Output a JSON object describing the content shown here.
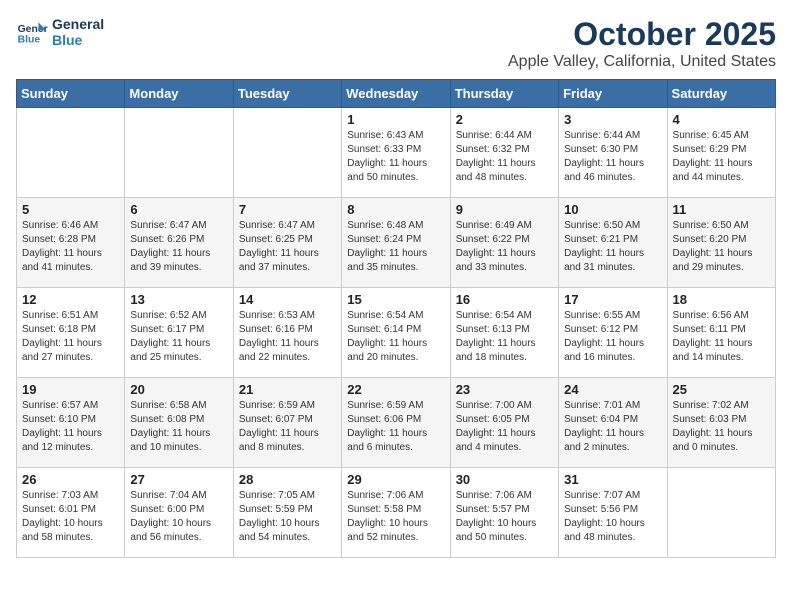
{
  "header": {
    "logo_line1": "General",
    "logo_line2": "Blue",
    "month": "October 2025",
    "location": "Apple Valley, California, United States"
  },
  "days_of_week": [
    "Sunday",
    "Monday",
    "Tuesday",
    "Wednesday",
    "Thursday",
    "Friday",
    "Saturday"
  ],
  "weeks": [
    [
      {
        "day": "",
        "content": ""
      },
      {
        "day": "",
        "content": ""
      },
      {
        "day": "",
        "content": ""
      },
      {
        "day": "1",
        "content": "Sunrise: 6:43 AM\nSunset: 6:33 PM\nDaylight: 11 hours\nand 50 minutes."
      },
      {
        "day": "2",
        "content": "Sunrise: 6:44 AM\nSunset: 6:32 PM\nDaylight: 11 hours\nand 48 minutes."
      },
      {
        "day": "3",
        "content": "Sunrise: 6:44 AM\nSunset: 6:30 PM\nDaylight: 11 hours\nand 46 minutes."
      },
      {
        "day": "4",
        "content": "Sunrise: 6:45 AM\nSunset: 6:29 PM\nDaylight: 11 hours\nand 44 minutes."
      }
    ],
    [
      {
        "day": "5",
        "content": "Sunrise: 6:46 AM\nSunset: 6:28 PM\nDaylight: 11 hours\nand 41 minutes."
      },
      {
        "day": "6",
        "content": "Sunrise: 6:47 AM\nSunset: 6:26 PM\nDaylight: 11 hours\nand 39 minutes."
      },
      {
        "day": "7",
        "content": "Sunrise: 6:47 AM\nSunset: 6:25 PM\nDaylight: 11 hours\nand 37 minutes."
      },
      {
        "day": "8",
        "content": "Sunrise: 6:48 AM\nSunset: 6:24 PM\nDaylight: 11 hours\nand 35 minutes."
      },
      {
        "day": "9",
        "content": "Sunrise: 6:49 AM\nSunset: 6:22 PM\nDaylight: 11 hours\nand 33 minutes."
      },
      {
        "day": "10",
        "content": "Sunrise: 6:50 AM\nSunset: 6:21 PM\nDaylight: 11 hours\nand 31 minutes."
      },
      {
        "day": "11",
        "content": "Sunrise: 6:50 AM\nSunset: 6:20 PM\nDaylight: 11 hours\nand 29 minutes."
      }
    ],
    [
      {
        "day": "12",
        "content": "Sunrise: 6:51 AM\nSunset: 6:18 PM\nDaylight: 11 hours\nand 27 minutes."
      },
      {
        "day": "13",
        "content": "Sunrise: 6:52 AM\nSunset: 6:17 PM\nDaylight: 11 hours\nand 25 minutes."
      },
      {
        "day": "14",
        "content": "Sunrise: 6:53 AM\nSunset: 6:16 PM\nDaylight: 11 hours\nand 22 minutes."
      },
      {
        "day": "15",
        "content": "Sunrise: 6:54 AM\nSunset: 6:14 PM\nDaylight: 11 hours\nand 20 minutes."
      },
      {
        "day": "16",
        "content": "Sunrise: 6:54 AM\nSunset: 6:13 PM\nDaylight: 11 hours\nand 18 minutes."
      },
      {
        "day": "17",
        "content": "Sunrise: 6:55 AM\nSunset: 6:12 PM\nDaylight: 11 hours\nand 16 minutes."
      },
      {
        "day": "18",
        "content": "Sunrise: 6:56 AM\nSunset: 6:11 PM\nDaylight: 11 hours\nand 14 minutes."
      }
    ],
    [
      {
        "day": "19",
        "content": "Sunrise: 6:57 AM\nSunset: 6:10 PM\nDaylight: 11 hours\nand 12 minutes."
      },
      {
        "day": "20",
        "content": "Sunrise: 6:58 AM\nSunset: 6:08 PM\nDaylight: 11 hours\nand 10 minutes."
      },
      {
        "day": "21",
        "content": "Sunrise: 6:59 AM\nSunset: 6:07 PM\nDaylight: 11 hours\nand 8 minutes."
      },
      {
        "day": "22",
        "content": "Sunrise: 6:59 AM\nSunset: 6:06 PM\nDaylight: 11 hours\nand 6 minutes."
      },
      {
        "day": "23",
        "content": "Sunrise: 7:00 AM\nSunset: 6:05 PM\nDaylight: 11 hours\nand 4 minutes."
      },
      {
        "day": "24",
        "content": "Sunrise: 7:01 AM\nSunset: 6:04 PM\nDaylight: 11 hours\nand 2 minutes."
      },
      {
        "day": "25",
        "content": "Sunrise: 7:02 AM\nSunset: 6:03 PM\nDaylight: 11 hours\nand 0 minutes."
      }
    ],
    [
      {
        "day": "26",
        "content": "Sunrise: 7:03 AM\nSunset: 6:01 PM\nDaylight: 10 hours\nand 58 minutes."
      },
      {
        "day": "27",
        "content": "Sunrise: 7:04 AM\nSunset: 6:00 PM\nDaylight: 10 hours\nand 56 minutes."
      },
      {
        "day": "28",
        "content": "Sunrise: 7:05 AM\nSunset: 5:59 PM\nDaylight: 10 hours\nand 54 minutes."
      },
      {
        "day": "29",
        "content": "Sunrise: 7:06 AM\nSunset: 5:58 PM\nDaylight: 10 hours\nand 52 minutes."
      },
      {
        "day": "30",
        "content": "Sunrise: 7:06 AM\nSunset: 5:57 PM\nDaylight: 10 hours\nand 50 minutes."
      },
      {
        "day": "31",
        "content": "Sunrise: 7:07 AM\nSunset: 5:56 PM\nDaylight: 10 hours\nand 48 minutes."
      },
      {
        "day": "",
        "content": ""
      }
    ]
  ]
}
